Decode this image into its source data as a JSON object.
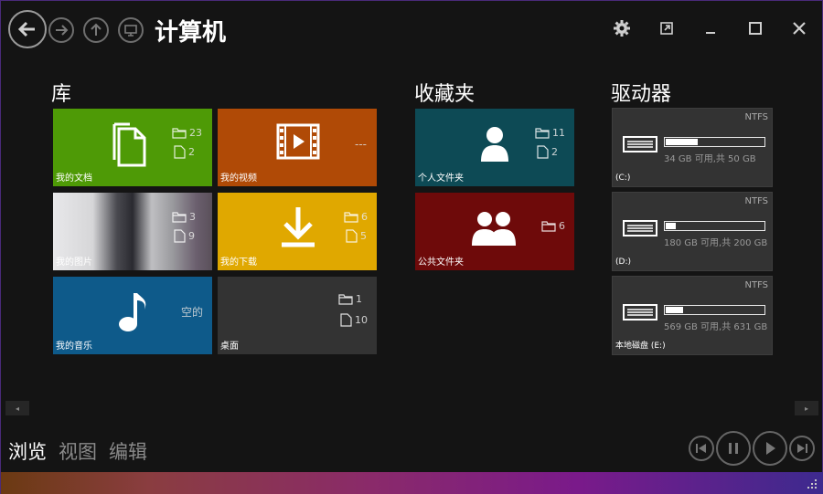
{
  "window": {
    "title": "计算机"
  },
  "sections": {
    "library": "库",
    "favorites": "收藏夹",
    "drives": "驱动器"
  },
  "library_tiles": [
    {
      "label": "我的文档",
      "color": "#4e9a06",
      "folders": "23",
      "files": "2",
      "icon": "documents-icon"
    },
    {
      "label": "我的视频",
      "color": "#b04a06",
      "note": "---",
      "icon": "film-icon"
    },
    {
      "label": "我的图片",
      "color": "#555",
      "folders": "3",
      "files": "9",
      "icon": "photo-thumbnail"
    },
    {
      "label": "我的下载",
      "color": "#e0a800",
      "folders": "6",
      "files": "5",
      "icon": "download-icon"
    },
    {
      "label": "我的音乐",
      "color": "#0e5a8a",
      "note": "空的",
      "icon": "music-note-icon"
    },
    {
      "label": "桌面",
      "color": "#333333",
      "folders": "1",
      "files": "10",
      "icon": ""
    }
  ],
  "favorite_tiles": [
    {
      "label": "个人文件夹",
      "color": "#0d4a55",
      "folders": "11",
      "files": "2",
      "icon": "user-icon"
    },
    {
      "label": "公共文件夹",
      "color": "#6e0a0a",
      "folders": "6",
      "icon": "users-icon"
    }
  ],
  "drive_tiles": [
    {
      "fs": "NTFS",
      "info": "34 GB 可用,共 50 GB",
      "label": "(C:)",
      "used_fraction": 0.32
    },
    {
      "fs": "NTFS",
      "info": "180 GB 可用,共 200 GB",
      "label": "(D:)",
      "used_fraction": 0.1
    },
    {
      "fs": "NTFS",
      "info": "569 GB 可用,共 631 GB",
      "label": "本地磁盘 (E:)",
      "used_fraction": 0.17
    }
  ],
  "bottom_tabs": [
    "浏览",
    "视图",
    "编辑"
  ],
  "colors": {
    "active_tab": "#ffffff",
    "inactive_tab": "#8a8a8a"
  }
}
